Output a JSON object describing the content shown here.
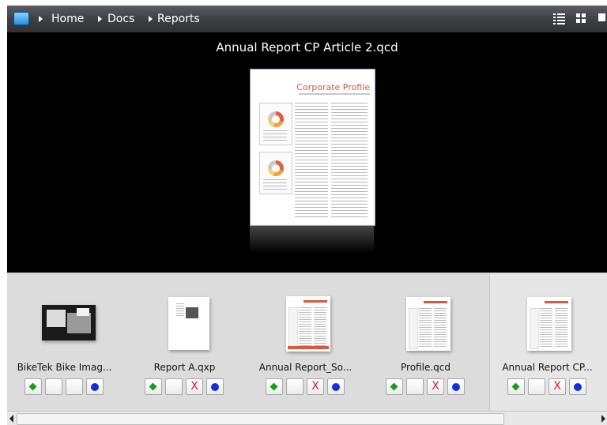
{
  "breadcrumb": {
    "items": [
      "Home",
      "Docs",
      "Reports"
    ]
  },
  "toolbar": {
    "icons": [
      "list-view-icon",
      "grid-view-icon",
      "monitor-icon"
    ]
  },
  "preview": {
    "title": "Annual Report CP Article 2.qcd",
    "doc_heading": "Corporate Profile"
  },
  "gallery": {
    "items": [
      {
        "label": "BikeTek Bike Imag...",
        "actions": [
          "add",
          "",
          "",
          "dot"
        ]
      },
      {
        "label": "Report A.qxp",
        "actions": [
          "add",
          "",
          "remove",
          "dot"
        ]
      },
      {
        "label": "Annual Report_So...",
        "actions": [
          "add",
          "",
          "remove",
          "dot"
        ]
      },
      {
        "label": "Profile.qcd",
        "actions": [
          "add",
          "",
          "remove",
          "dot"
        ]
      },
      {
        "label": "Annual Report CP...",
        "actions": [
          "add",
          "",
          "remove",
          "dot"
        ],
        "selected": true
      }
    ],
    "action_symbols": {
      "add": "green-diamond",
      "remove": "X",
      "dot": "blue-dot"
    }
  },
  "colors": {
    "accent_green": "#16a016",
    "accent_red": "#e02020",
    "accent_blue": "#1030e0",
    "doc_heading": "#e0563a"
  }
}
